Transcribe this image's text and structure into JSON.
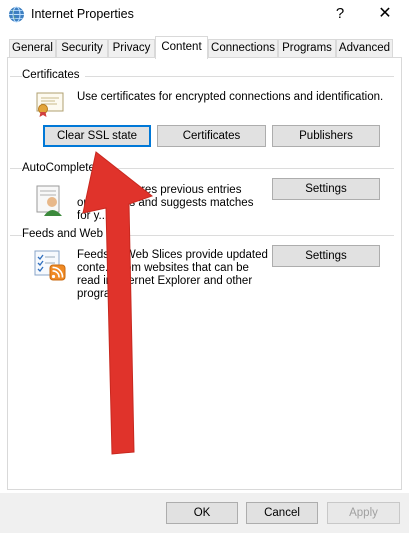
{
  "window": {
    "title": "Internet Properties",
    "help_label": "?",
    "close_label": "✕"
  },
  "tabs": [
    {
      "label": "General"
    },
    {
      "label": "Security"
    },
    {
      "label": "Privacy"
    },
    {
      "label": "Content",
      "active": true
    },
    {
      "label": "Connections"
    },
    {
      "label": "Programs"
    },
    {
      "label": "Advanced"
    }
  ],
  "certificates": {
    "group_label": "Certificates",
    "description": "Use certificates for encrypted connections and identification.",
    "clear_ssl_label": "Clear SSL state",
    "certificates_label": "Certificates",
    "publishers_label": "Publishers"
  },
  "autocomplete": {
    "group_label": "AutoComplete",
    "description_lines": [
      "...ete stores previous entries",
      "on w...ages and suggests matches",
      "for y..."
    ],
    "settings_label": "Settings"
  },
  "feeds": {
    "group_label": "Feeds and Web S...",
    "description_lines": [
      "Feeds ... Web Slices provide updated",
      "conte... from websites that can be",
      "read in Internet Explorer and other",
      "programs."
    ],
    "settings_label": "Settings"
  },
  "footer": {
    "ok_label": "OK",
    "cancel_label": "Cancel",
    "apply_label": "Apply"
  },
  "colors": {
    "arrow": "#e0332b",
    "focus_border": "#0078d7"
  },
  "icons": {
    "window": "internet-globe-icon",
    "certificate": "certificate-icon",
    "autocomplete": "user-form-icon",
    "feeds": "rss-feed-icon"
  }
}
